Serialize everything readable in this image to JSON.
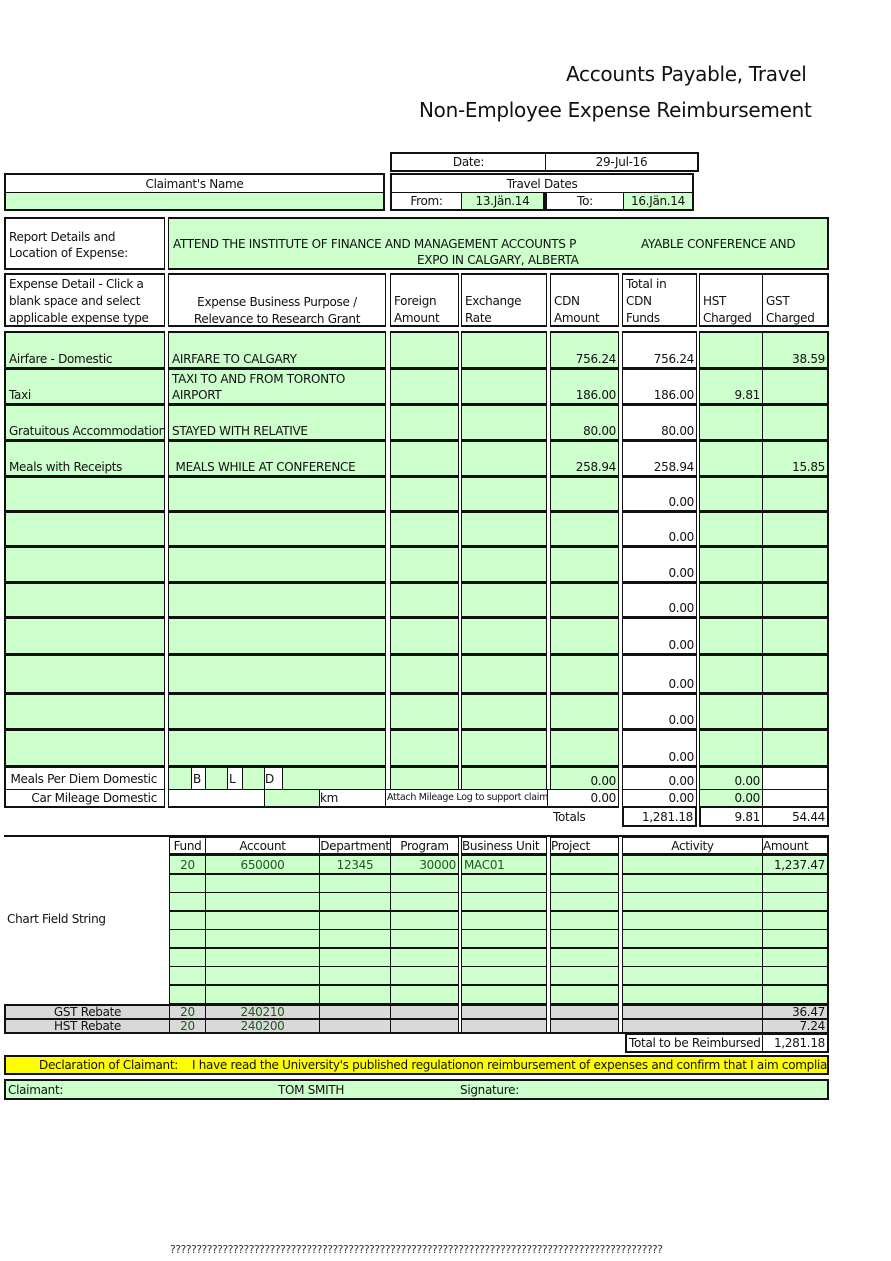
{
  "header": {
    "title_line1": "Accounts Payable, Travel",
    "title_line2": "Non-Employee Expense Reimbursement"
  },
  "date_block": {
    "date_label": "Date:",
    "date_value": "29-Jul-16",
    "travel_dates_label": "Travel Dates",
    "from_label": "From:",
    "from_value": "13.Jän.14",
    "to_label": "To:",
    "to_value": "16.Jän.14"
  },
  "claimant_name": {
    "label": "Claimant's Name",
    "value": ""
  },
  "report_details": {
    "label_line1": "Report Details and",
    "label_line2": "Location of Expense:",
    "value_line1_a": "ATTEND THE INSTITUTE OF FINANCE AND MANAGEMENT ACCOUNTS P",
    "value_line1_b": "AYABLE CONFERENCE AND",
    "value_line2": "EXPO IN CALGARY, ALBERTA"
  },
  "expense_table": {
    "headers": {
      "detail_line1": "Expense Detail - Click a",
      "detail_line2": "blank space and select",
      "detail_line3": "applicable expense type",
      "purpose_line1": "Expense Business Purpose /",
      "purpose_line2": "Relevance to Research Grant",
      "foreign_line1": "Foreign",
      "foreign_line2": "Amount",
      "exchange_line1": "Exchange",
      "exchange_line2": "Rate",
      "cdn_line1": "CDN",
      "cdn_line2": "Amount",
      "total_line1": "Total in",
      "total_line2": "CDN",
      "total_line3": "Funds",
      "hst_line1": "HST",
      "hst_line2": "Charged",
      "gst_line1": "GST",
      "gst_line2": "Charged"
    },
    "rows": [
      {
        "type": "Airfare - Domestic",
        "purpose_line1": "AIRFARE TO CALGARY",
        "purpose_line2": "",
        "foreign": "",
        "exchange": "",
        "cdn": "756.24",
        "total": "756.24",
        "hst": "",
        "gst": "38.59"
      },
      {
        "type": "Taxi",
        "purpose_line1": "TAXI TO AND FROM TORONTO",
        "purpose_line2": "AIRPORT",
        "foreign": "",
        "exchange": "",
        "cdn": "186.00",
        "total": "186.00",
        "hst": "9.81",
        "gst": ""
      },
      {
        "type": "Gratuitous Accommodation",
        "purpose_line1": "STAYED WITH RELATIVE",
        "purpose_line2": "",
        "foreign": "",
        "exchange": "",
        "cdn": "80.00",
        "total": "80.00",
        "hst": "",
        "gst": ""
      },
      {
        "type": "Meals with Receipts",
        "purpose_line1": " MEALS WHILE AT CONFERENCE",
        "purpose_line2": "",
        "foreign": "",
        "exchange": "",
        "cdn": "258.94",
        "total": "258.94",
        "hst": "",
        "gst": "15.85"
      },
      {
        "type": "",
        "purpose_line1": "",
        "purpose_line2": "",
        "foreign": "",
        "exchange": "",
        "cdn": "",
        "total": "0.00",
        "hst": "",
        "gst": ""
      },
      {
        "type": "",
        "purpose_line1": "",
        "purpose_line2": "",
        "foreign": "",
        "exchange": "",
        "cdn": "",
        "total": "0.00",
        "hst": "",
        "gst": ""
      },
      {
        "type": "",
        "purpose_line1": "",
        "purpose_line2": "",
        "foreign": "",
        "exchange": "",
        "cdn": "",
        "total": "0.00",
        "hst": "",
        "gst": ""
      },
      {
        "type": "",
        "purpose_line1": "",
        "purpose_line2": "",
        "foreign": "",
        "exchange": "",
        "cdn": "",
        "total": "0.00",
        "hst": "",
        "gst": ""
      },
      {
        "type": "",
        "purpose_line1": "",
        "purpose_line2": "",
        "foreign": "",
        "exchange": "",
        "cdn": "",
        "total": "0.00",
        "hst": "",
        "gst": ""
      },
      {
        "type": "",
        "purpose_line1": "",
        "purpose_line2": "",
        "foreign": "",
        "exchange": "",
        "cdn": "",
        "total": "0.00",
        "hst": "",
        "gst": ""
      },
      {
        "type": "",
        "purpose_line1": "",
        "purpose_line2": "",
        "foreign": "",
        "exchange": "",
        "cdn": "",
        "total": "0.00",
        "hst": "",
        "gst": ""
      },
      {
        "type": "",
        "purpose_line1": "",
        "purpose_line2": "",
        "foreign": "",
        "exchange": "",
        "cdn": "",
        "total": "0.00",
        "hst": "",
        "gst": ""
      }
    ],
    "per_diem": {
      "label": "Meals Per Diem Domestic",
      "b_label": "B",
      "l_label": "L",
      "d_label": "D",
      "cdn": "0.00",
      "total": "0.00",
      "hst": "0.00"
    },
    "mileage": {
      "label": "Car Mileage Domestic",
      "km_label": "km",
      "note": "Attach Mileage Log to support claim",
      "cdn": "0.00",
      "total": "0.00",
      "hst": "0.00"
    },
    "totals": {
      "label": "Totals",
      "total": "1,281.18",
      "hst": "9.81",
      "gst": "54.44"
    }
  },
  "chart_field": {
    "label": "Chart Field String",
    "headers": [
      "Fund",
      "Account",
      "Department",
      "Program",
      "Business Unit",
      "Project",
      "Activity",
      "Amount"
    ],
    "rows": [
      [
        "20",
        "650000",
        "12345",
        "30000",
        "MAC01",
        "",
        "",
        "1,237.47"
      ],
      [
        "",
        "",
        "",
        "",
        "",
        "",
        "",
        ""
      ],
      [
        "",
        "",
        "",
        "",
        "",
        "",
        "",
        ""
      ],
      [
        "",
        "",
        "",
        "",
        "",
        "",
        "",
        ""
      ],
      [
        "",
        "",
        "",
        "",
        "",
        "",
        "",
        ""
      ],
      [
        "",
        "",
        "",
        "",
        "",
        "",
        "",
        ""
      ],
      [
        "",
        "",
        "",
        "",
        "",
        "",
        "",
        ""
      ],
      [
        "",
        "",
        "",
        "",
        "",
        "",
        "",
        ""
      ]
    ],
    "gst_rebate": {
      "label": "GST Rebate",
      "fund": "20",
      "account": "240210",
      "amount": "36.47"
    },
    "hst_rebate": {
      "label": "HST Rebate",
      "fund": "20",
      "account": "240200",
      "amount": "7.24"
    },
    "total_reimbursed_label": "Total to be Reimbursed",
    "total_reimbursed_value": "1,281.18"
  },
  "declaration": {
    "label": "Declaration of Claimant:",
    "text": "I have read the University's published regulationon reimbursement of expenses and confirm that I aim compliance."
  },
  "signature_row": {
    "claimant_label": "Claimant:",
    "claimant_value": "TOM SMITH",
    "signature_label": "Signature:"
  },
  "footer": {
    "garbled_text": "??????????????????????????????????????????????????????????????????????????????????????????????"
  }
}
